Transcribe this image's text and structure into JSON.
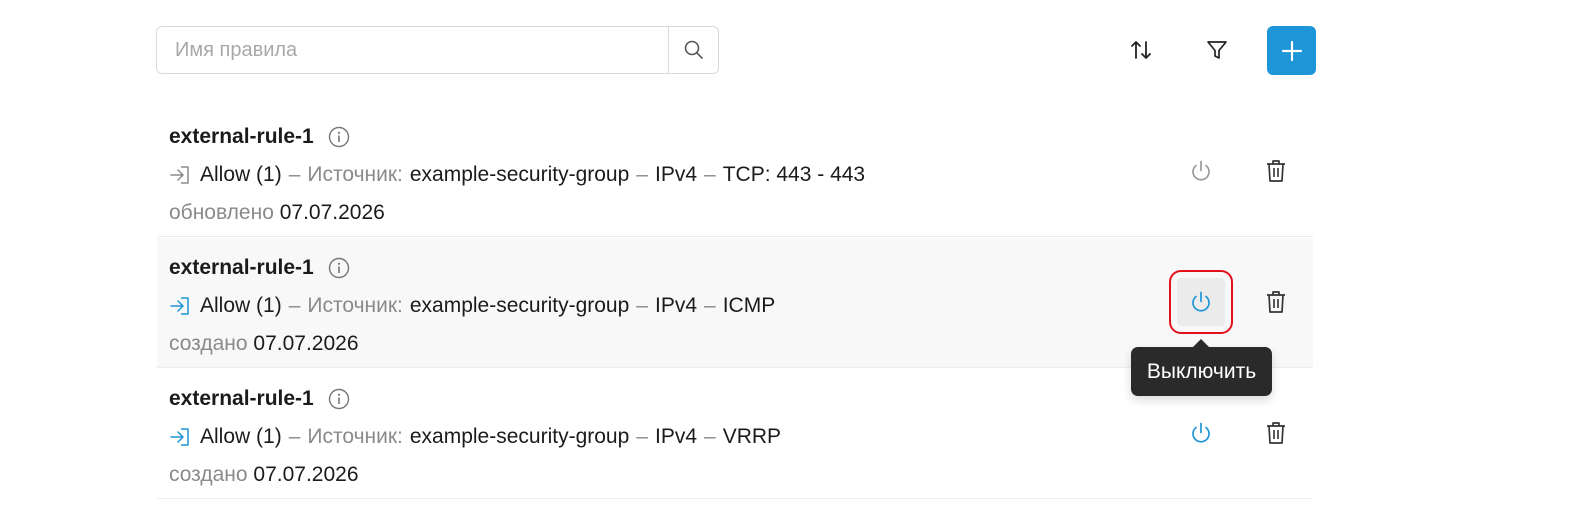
{
  "search": {
    "placeholder": "Имя правила",
    "value": ""
  },
  "toolbar": {
    "sort_icon": "sort-icon",
    "filter_icon": "filter-icon",
    "add_icon": "plus-icon",
    "accent_color": "#1e95d6"
  },
  "rules": [
    {
      "name": "external-rule-1",
      "action": "Allow (1)",
      "sep1": "–",
      "source_label": "Источник:",
      "source": "example-security-group",
      "sep2": "–",
      "ip": "IPv4",
      "sep3": "–",
      "protocol": "TCP: 443 - 443",
      "date_label": "обновлено",
      "date": "07.07.2026",
      "enabled": false
    },
    {
      "name": "external-rule-1",
      "action": "Allow (1)",
      "sep1": "–",
      "source_label": "Источник:",
      "source": "example-security-group",
      "sep2": "–",
      "ip": "IPv4",
      "sep3": "–",
      "protocol": "ICMP",
      "date_label": "создано",
      "date": "07.07.2026",
      "enabled": true
    },
    {
      "name": "external-rule-1",
      "action": "Allow (1)",
      "sep1": "–",
      "source_label": "Источник:",
      "source": "example-security-group",
      "sep2": "–",
      "ip": "IPv4",
      "sep3": "–",
      "protocol": "VRRP",
      "date_label": "создано",
      "date": "07.07.2026",
      "enabled": true
    }
  ],
  "tooltip": {
    "text": "Выключить"
  }
}
